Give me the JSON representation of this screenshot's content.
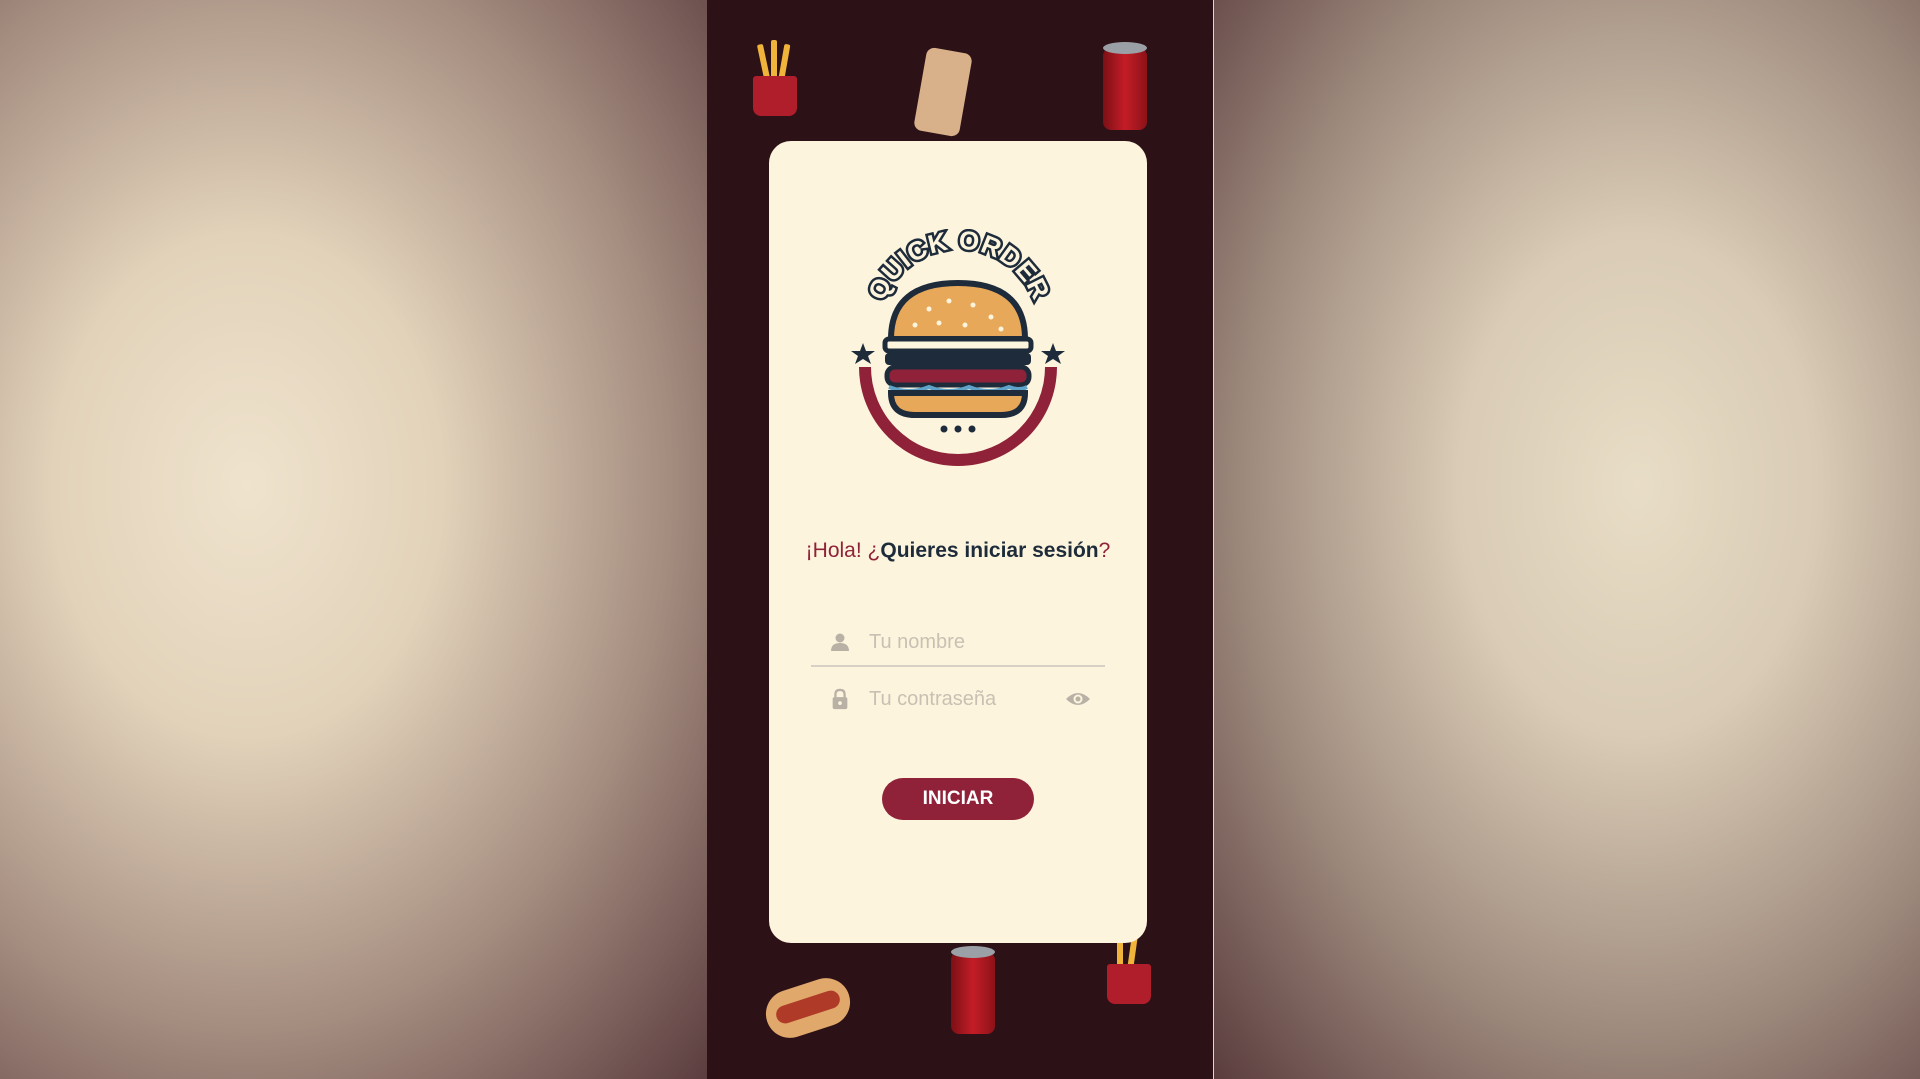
{
  "greeting": {
    "hola": "¡Hola!",
    "open_q": "¿",
    "question": "Quieres iniciar sesión",
    "close_q": "?"
  },
  "form": {
    "name_placeholder": "Tu nombre",
    "password_placeholder": "Tu contraseña",
    "submit_label": "INICIAR"
  },
  "logo": {
    "text": "QUICK ORDER"
  },
  "icons": {
    "name_field": "user-icon",
    "password_field": "lock-icon",
    "toggle_visibility": "eye-icon"
  },
  "colors": {
    "accent": "#8f2238",
    "background": "#2c1117",
    "card": "#fdf4dd",
    "text_dark": "#1d2b3a"
  }
}
